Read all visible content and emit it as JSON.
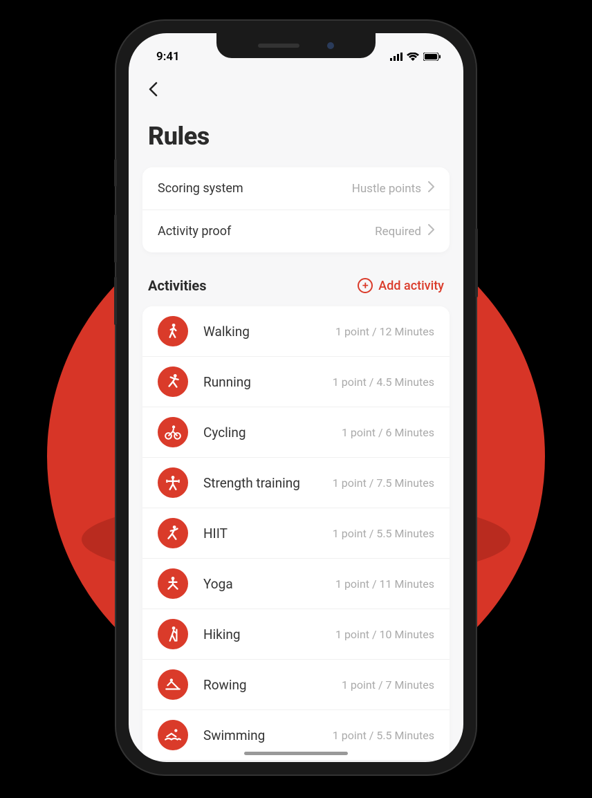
{
  "status": {
    "time": "9:41"
  },
  "page_title": "Rules",
  "settings": [
    {
      "label": "Scoring system",
      "value": "Hustle points"
    },
    {
      "label": "Activity proof",
      "value": "Required"
    }
  ],
  "activities_header": "Activities",
  "add_activity_label": "Add activity",
  "activities": [
    {
      "name": "Walking",
      "points": "1 point / 12 Minutes",
      "icon": "walking"
    },
    {
      "name": "Running",
      "points": "1 point / 4.5 Minutes",
      "icon": "running"
    },
    {
      "name": "Cycling",
      "points": "1 point / 6 Minutes",
      "icon": "cycling"
    },
    {
      "name": "Strength training",
      "points": "1 point / 7.5 Minutes",
      "icon": "strength"
    },
    {
      "name": "HIIT",
      "points": "1 point / 5.5 Minutes",
      "icon": "hiit"
    },
    {
      "name": "Yoga",
      "points": "1 point / 11 Minutes",
      "icon": "yoga"
    },
    {
      "name": "Hiking",
      "points": "1 point / 10 Minutes",
      "icon": "hiking"
    },
    {
      "name": "Rowing",
      "points": "1 point / 7 Minutes",
      "icon": "rowing"
    },
    {
      "name": "Swimming",
      "points": "1 point / 5.5 Minutes",
      "icon": "swimming"
    }
  ],
  "colors": {
    "accent": "#da3b2a"
  }
}
